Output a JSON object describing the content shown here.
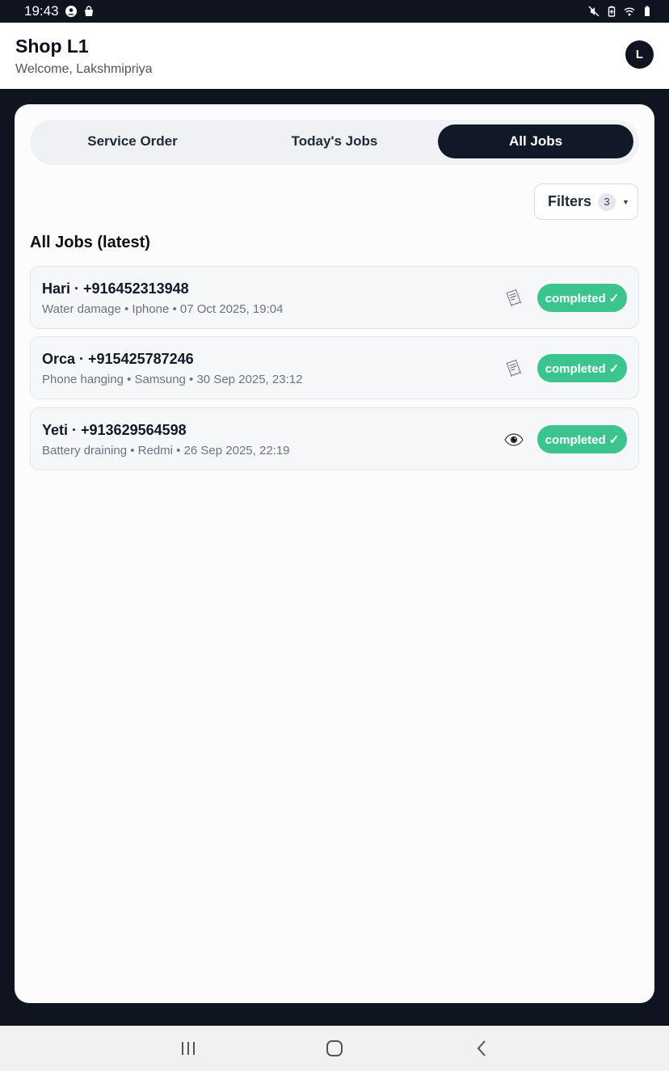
{
  "status_bar": {
    "time": "19:43"
  },
  "header": {
    "shop_name": "Shop L1",
    "welcome": "Welcome, Lakshmipriya",
    "avatar_initial": "L"
  },
  "tabs": [
    {
      "label": "Service Order",
      "active": false
    },
    {
      "label": "Today's Jobs",
      "active": false
    },
    {
      "label": "All Jobs",
      "active": true
    }
  ],
  "filters": {
    "label": "Filters",
    "count": "3"
  },
  "section_title": "All Jobs (latest)",
  "jobs": [
    {
      "title": "Hari · +916452313948",
      "meta": "Water damage • Iphone • 07 Oct 2025, 19:04",
      "icon": "receipt-icon",
      "status": "completed ✓"
    },
    {
      "title": "Orca · +915425787246",
      "meta": "Phone hanging • Samsung • 30 Sep 2025, 23:12",
      "icon": "receipt-icon",
      "status": "completed ✓"
    },
    {
      "title": "Yeti · +913629564598",
      "meta": "Battery draining • Redmi • 26 Sep 2025, 22:19",
      "icon": "eye-icon",
      "status": "completed ✓"
    }
  ],
  "colors": {
    "dark": "#0f1420",
    "accent_green": "#3cc48e",
    "card_bg": "#f6f7f9"
  }
}
